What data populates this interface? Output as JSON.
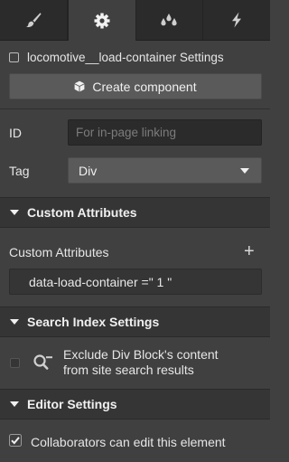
{
  "tabs": [
    {
      "name": "brush-icon",
      "active": false
    },
    {
      "name": "gear-icon",
      "active": true
    },
    {
      "name": "drops-icon",
      "active": false
    },
    {
      "name": "lightning-icon",
      "active": false
    }
  ],
  "settings_title": "locomotive__load-container Settings",
  "create_component_label": "Create component",
  "id_label": "ID",
  "id_placeholder": "For in-page linking",
  "tag_label": "Tag",
  "tag_value": "Div",
  "sections": {
    "custom_attributes": "Custom Attributes",
    "search_index": "Search Index Settings",
    "editor": "Editor Settings"
  },
  "custom_attributes": {
    "subtitle": "Custom Attributes",
    "add_symbol": "+",
    "items": [
      {
        "text": "data-load-container =\" 1 \""
      }
    ]
  },
  "search_index": {
    "exclude_line1": "Exclude Div Block's content",
    "exclude_line2": "from site search results",
    "checked": false
  },
  "editor": {
    "collab_label": "Collaborators can edit this element",
    "checked": true
  }
}
